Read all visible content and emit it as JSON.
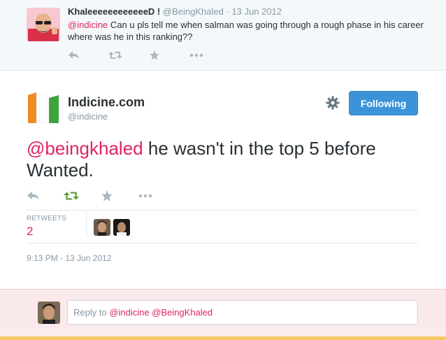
{
  "parent_tweet": {
    "display_name": "KhaleeeeeeeeeeeeD !",
    "handle": "@BeingKhaled",
    "separator": "·",
    "date": "13 Jun 2012",
    "mention": "@indicine",
    "text": " Can u pls tell me when salman was going through a rough phase in his career where was he in this ranking??"
  },
  "main_tweet": {
    "display_name": "Indicine.com",
    "handle": "@indicine",
    "follow_button": "Following",
    "mention": "@beingkhaled",
    "text": " he wasn't in the top 5 before Wanted.",
    "retweets_label": "RETWEETS",
    "retweets_count": "2",
    "timestamp": "9:13 PM - 13 Jun 2012"
  },
  "reply": {
    "prefix": "Reply to ",
    "mentions": "@indicine @BeingKhaled"
  },
  "colors": {
    "accent_red": "#e0245e",
    "follow_blue": "#3b94d9",
    "retweet_green": "#19cf86",
    "muted": "#8899a6"
  },
  "icons": [
    "reply-icon",
    "retweet-icon",
    "favorite-icon",
    "more-icon",
    "gear-icon"
  ]
}
